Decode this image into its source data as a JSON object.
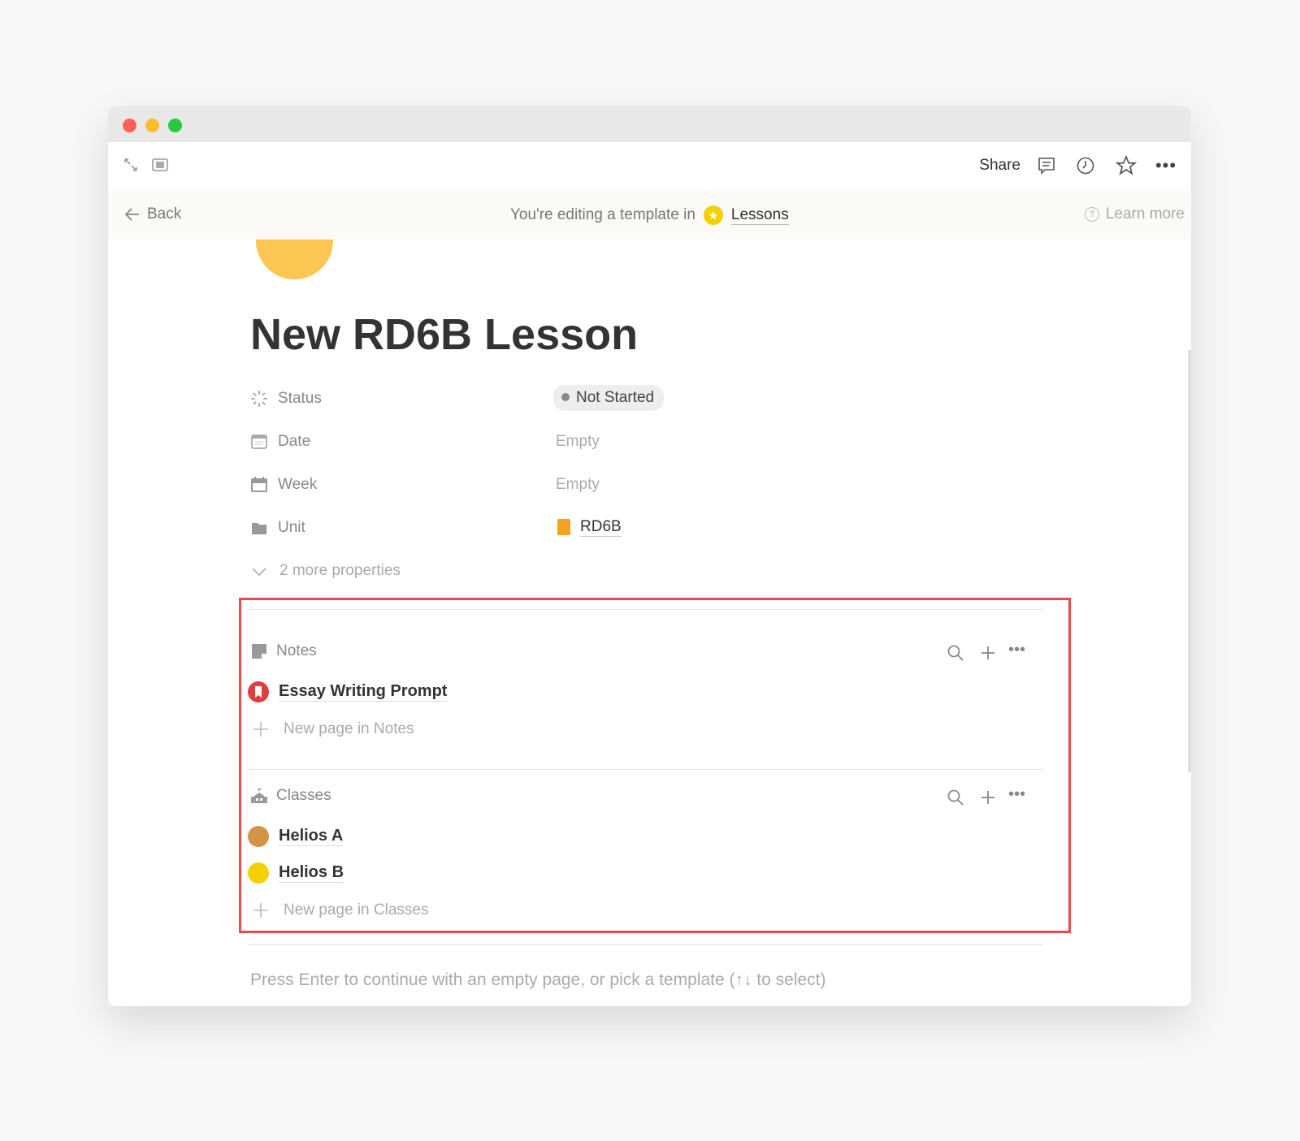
{
  "window": {
    "controls": [
      "close",
      "minimize",
      "maximize"
    ],
    "colors": {
      "close": "#fe5f57",
      "minimize": "#febc2e",
      "maximize": "#28c840"
    }
  },
  "toolbar": {
    "share_label": "Share",
    "icons": [
      "expand-icon",
      "sidebar-icon",
      "comment-icon",
      "history-icon",
      "star-icon",
      "more-icon"
    ]
  },
  "banner": {
    "back_label": "Back",
    "message": "You're editing a template in",
    "database": "Lessons",
    "learn_more": "Learn more"
  },
  "page": {
    "title": "New RD6B Lesson",
    "properties": [
      {
        "label": "Status",
        "value": "Not Started",
        "icon": "status-icon"
      },
      {
        "label": "Date",
        "value": "Empty",
        "icon": "calendar-icon"
      },
      {
        "label": "Week",
        "value": "Empty",
        "icon": "calendar-filled-icon"
      },
      {
        "label": "Unit",
        "value": "RD6B",
        "icon": "folder-icon"
      }
    ],
    "more_properties": "2 more properties"
  },
  "notes": {
    "title": "Notes",
    "items": [
      "Essay Writing Prompt"
    ],
    "new_page": "New page in Notes"
  },
  "classes": {
    "title": "Classes",
    "items": [
      "Helios A",
      "Helios B"
    ],
    "new_page": "New page in Classes"
  },
  "footer": "Press Enter to continue with an empty page, or pick a template (↑↓ to select)",
  "highlight_color": "#e84a4a"
}
